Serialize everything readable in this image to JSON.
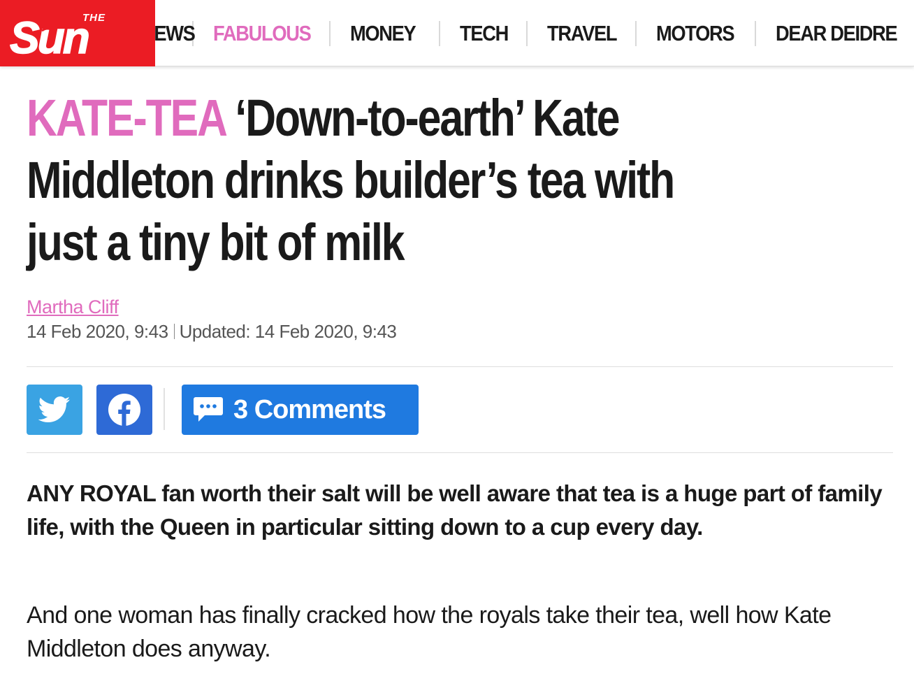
{
  "brand": {
    "logo_small": "THE",
    "logo_main": "Sun",
    "accent": "#eb1c24"
  },
  "nav": {
    "items": [
      {
        "label": "NEWS",
        "color": "#1a1a1a"
      },
      {
        "label": "FABULOUS",
        "color": "#e06bbd"
      },
      {
        "label": "MONEY",
        "color": "#1a1a1a"
      },
      {
        "label": "TECH",
        "color": "#1a1a1a"
      },
      {
        "label": "TRAVEL",
        "color": "#1a1a1a"
      },
      {
        "label": "MOTORS",
        "color": "#1a1a1a"
      },
      {
        "label": "DEAR DEIDRE",
        "color": "#1a1a1a"
      }
    ]
  },
  "article": {
    "kicker": "KATE-TEA",
    "headline_lines": [
      "‘Down-to-earth’ Kate",
      "Middleton drinks builder’s tea with",
      "just a tiny bit of milk"
    ],
    "author": "Martha Cliff",
    "published": "14 Feb 2020, 9:43",
    "updated": "Updated: 14 Feb 2020, 9:43",
    "lead": "ANY ROYAL fan worth their salt will be well aware that tea is a huge part of family life, with the Queen in particular sitting down to a cup every day.",
    "paragraph": "And one woman has finally cracked how the royals take their tea, well how Kate Middleton does anyway."
  },
  "share": {
    "twitter_icon": "twitter-bird-icon",
    "facebook_icon": "facebook-f-icon",
    "comments_icon": "speech-bubble-icon",
    "comments_label": "3 Comments",
    "twitter_color": "#3aa3e3",
    "facebook_color": "#2e6ad6",
    "comments_color": "#1f7ae0"
  }
}
